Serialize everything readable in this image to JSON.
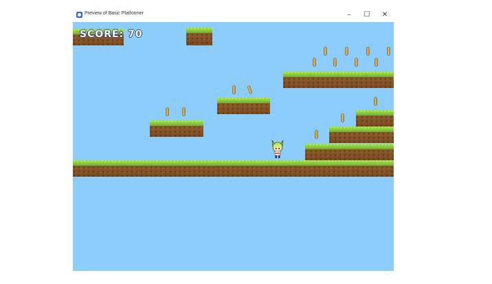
{
  "window": {
    "title": "Preview of Basic Platformer",
    "minimize_glyph": "–",
    "maximize_glyph": "☐",
    "close_glyph": "✕"
  },
  "hud": {
    "score_label": "SCORE:",
    "score_value": "70"
  },
  "colors": {
    "sky": "#8dcdfc",
    "grass": "#86c83a",
    "dirt": "#8b5a2b",
    "coin": "#e0b23a"
  }
}
